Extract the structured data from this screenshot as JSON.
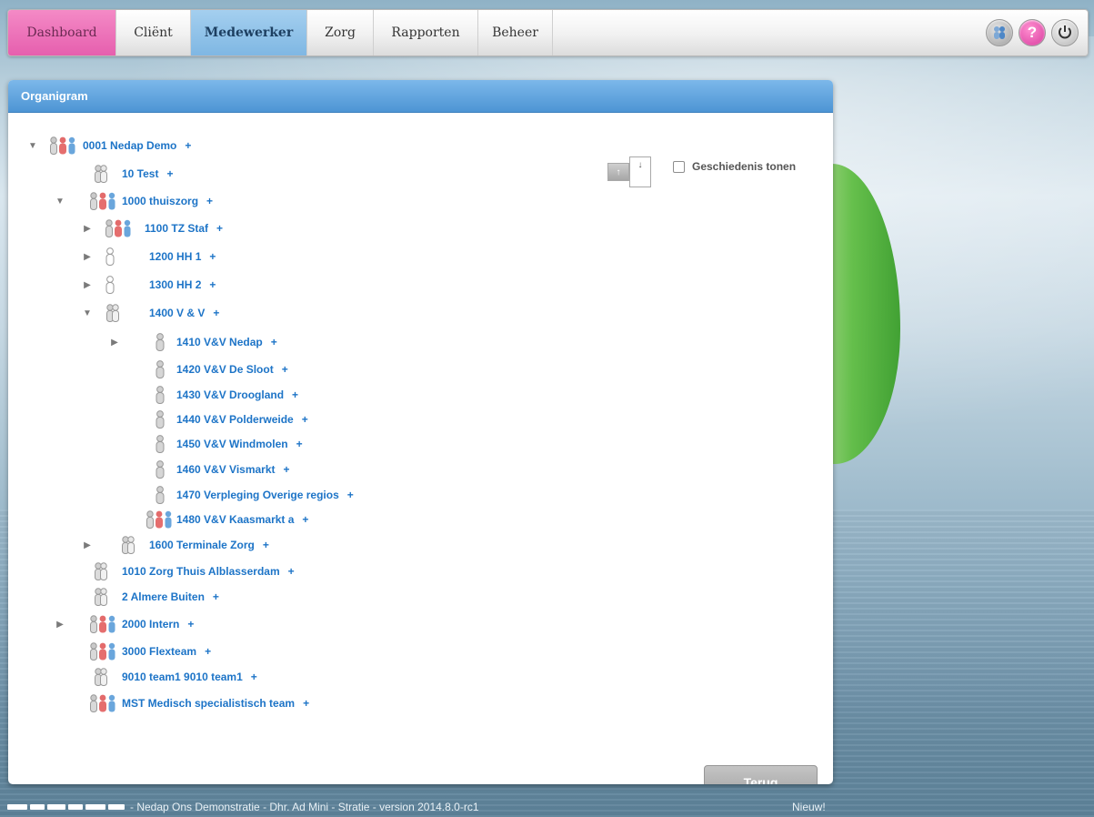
{
  "nav": {
    "tabs": [
      {
        "label": "Dashboard"
      },
      {
        "label": "Cliënt"
      },
      {
        "label": "Medewerker"
      },
      {
        "label": "Zorg"
      },
      {
        "label": "Rapporten"
      },
      {
        "label": "Beheer"
      }
    ],
    "active_tab": "Medewerker",
    "help_label": "?"
  },
  "panel": {
    "title": "Organigram",
    "history_label": "Geschiedenis tonen",
    "back_button": "Terug"
  },
  "tree": [
    {
      "label": "0001 Nedap Demo",
      "plus": "+",
      "expanded": true,
      "icon": "group-icon"
    },
    {
      "label": "10 Test",
      "plus": "+",
      "icon": "people-icon"
    },
    {
      "label": "1000 thuiszorg",
      "plus": "+",
      "expanded": true,
      "icon": "group-icon"
    },
    {
      "label": "1100 TZ Staf",
      "plus": "+",
      "expanded": false,
      "icon": "group-icon"
    },
    {
      "label": "1200 HH 1",
      "plus": "+",
      "expanded": false,
      "icon": "person-outline-icon"
    },
    {
      "label": "1300 HH 2",
      "plus": "+",
      "expanded": false,
      "icon": "person-outline-icon"
    },
    {
      "label": "1400 V & V",
      "plus": "+",
      "expanded": true,
      "icon": "people-icon"
    },
    {
      "label": "1410 V&V Nedap",
      "plus": "+",
      "expanded": false,
      "icon": "person-icon"
    },
    {
      "label": "1420 V&V De Sloot",
      "plus": "+",
      "icon": "person-icon"
    },
    {
      "label": "1430 V&V Droogland",
      "plus": "+",
      "icon": "person-icon"
    },
    {
      "label": "1440 V&V Polderweide",
      "plus": "+",
      "icon": "person-icon"
    },
    {
      "label": "1450 V&V Windmolen",
      "plus": "+",
      "icon": "person-icon"
    },
    {
      "label": "1460 V&V Vismarkt",
      "plus": "+",
      "icon": "person-icon"
    },
    {
      "label": "1470 Verpleging Overige regios",
      "plus": "+",
      "icon": "person-icon"
    },
    {
      "label": "1480 V&V Kaasmarkt a",
      "plus": "+",
      "icon": "group-icon"
    },
    {
      "label": "1600 Terminale Zorg",
      "plus": "+",
      "expanded": false,
      "icon": "people-icon"
    },
    {
      "label": "1010 Zorg Thuis Alblasserdam",
      "plus": "+",
      "icon": "people-icon"
    },
    {
      "label": "2 Almere Buiten",
      "plus": "+",
      "icon": "people-icon"
    },
    {
      "label": "2000 Intern",
      "plus": "+",
      "expanded": false,
      "icon": "group-icon"
    },
    {
      "label": "3000 Flexteam",
      "plus": "+",
      "icon": "group-icon"
    },
    {
      "label": "9010 team1 9010 team1",
      "plus": "+",
      "icon": "people-icon"
    },
    {
      "label": "MST Medisch specialistisch team",
      "plus": "+",
      "icon": "group-icon"
    }
  ],
  "footer": {
    "text": "- Nedap Ons Demonstratie - Dhr. Ad Mini - Stratie - version 2014.8.0-rc1",
    "new_label": "Nieuw!"
  },
  "colors": {
    "dashboard_tab": "#e65fae",
    "active_tab": "#7fb7e3",
    "panel_header": "#4d95d4",
    "link": "#1d74c7"
  }
}
